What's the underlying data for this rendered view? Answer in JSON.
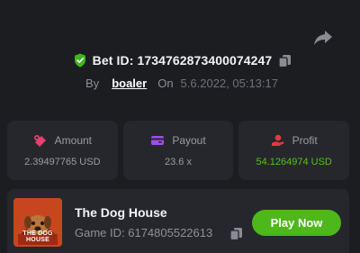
{
  "bet": {
    "title": "Bet ID: 1734762873400074247",
    "by_label": "By",
    "username": "boaler",
    "on_label": "On",
    "datetime": "5.6.2022, 05:13:17"
  },
  "stats": [
    {
      "label": "Amount",
      "value": "2.39497765 USD",
      "icon": "coins-icon"
    },
    {
      "label": "Payout",
      "value": "23.6 x",
      "icon": "wallet-card-icon"
    },
    {
      "label": "Profit",
      "value": "54.1264974 USD",
      "icon": "hand-coin-icon"
    }
  ],
  "game": {
    "name": "The Dog House",
    "id_text": "Game ID: 6174805522613",
    "thumbnail_text": "THE DOG HOUSE",
    "play_label": "Play Now"
  },
  "colors": {
    "background": "#1c1d21",
    "panel": "#26272c",
    "accent_green": "#4eb71a",
    "profit_green": "#53c31b",
    "amount_icon": "#e8406f",
    "payout_icon": "#a04de8",
    "profit_icon": "#e23a3a"
  }
}
